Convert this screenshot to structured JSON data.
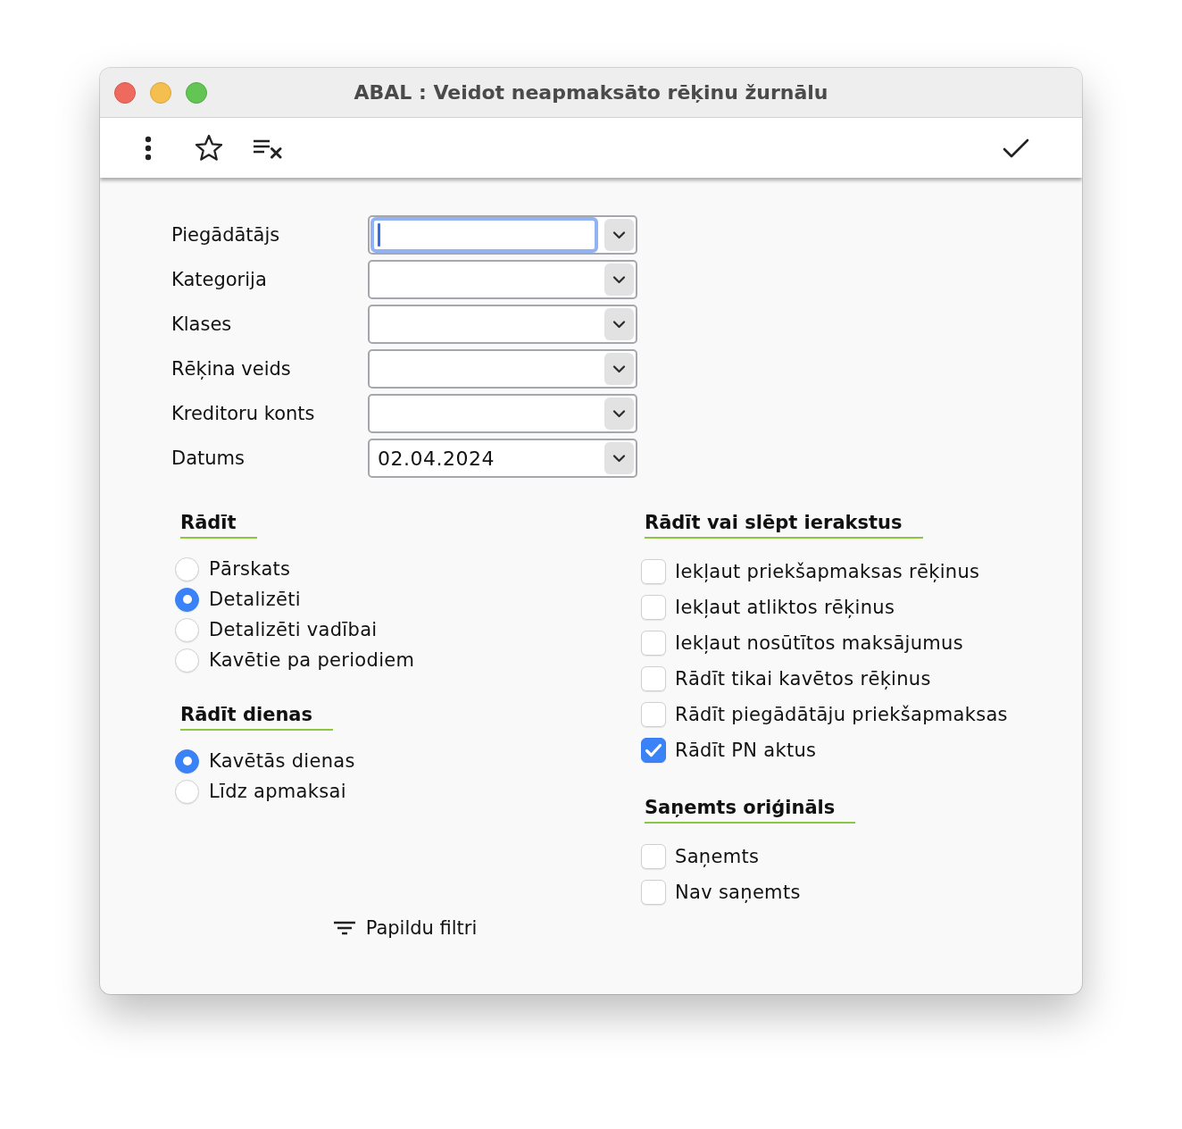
{
  "window": {
    "title": "ABAL : Veidot neapmaksāto rēķinu žurnālu"
  },
  "form": {
    "fields": [
      {
        "label": "Piegādātājs",
        "focused": true
      },
      {
        "label": "Kategorija",
        "focused": false
      },
      {
        "label": "Klases",
        "focused": false
      },
      {
        "label": "Rēķina veids",
        "focused": false
      },
      {
        "label": "Kreditoru konts",
        "focused": false
      },
      {
        "label": "Datums",
        "value": "02.04.2024",
        "focused": false
      }
    ]
  },
  "show": {
    "heading": "Rādīt",
    "options": [
      {
        "label": "Pārskats",
        "selected": false
      },
      {
        "label": "Detalizēti",
        "selected": true
      },
      {
        "label": "Detalizēti vadībai",
        "selected": false
      },
      {
        "label": "Kavētie pa periodiem",
        "selected": false
      }
    ]
  },
  "show_days": {
    "heading": "Rādīt dienas",
    "options": [
      {
        "label": "Kavētās dienas",
        "selected": true
      },
      {
        "label": "Līdz apmaksai",
        "selected": false
      }
    ]
  },
  "show_or_hide_records": {
    "heading": "Rādīt vai slēpt ierakstus",
    "options": [
      {
        "label": "Iekļaut priekšapmaksas rēķinus",
        "checked": false
      },
      {
        "label": "Iekļaut atliktos rēķinus",
        "checked": false
      },
      {
        "label": "Iekļaut nosūtītos maksājumus",
        "checked": false
      },
      {
        "label": "Rādīt tikai kavētos rēķinus",
        "checked": false
      },
      {
        "label": "Rādīt piegādātāju priekšapmaksas",
        "checked": false
      },
      {
        "label": "Rādīt PN aktus",
        "checked": true
      }
    ]
  },
  "original_received": {
    "heading": "Saņemts oriģināls",
    "options": [
      {
        "label": "Saņemts",
        "checked": false
      },
      {
        "label": "Nav saņemts",
        "checked": false
      }
    ]
  },
  "more_filters": {
    "label": "Papildu filtri"
  }
}
